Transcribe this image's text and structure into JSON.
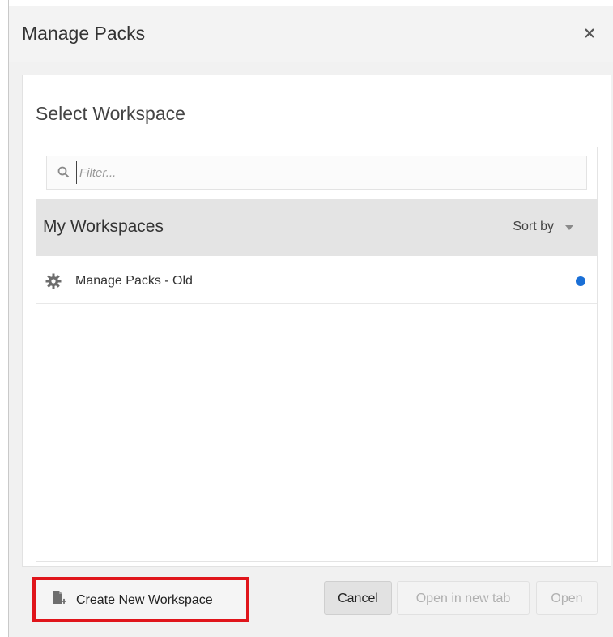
{
  "dialog": {
    "title": "Manage Packs",
    "close_icon": "close-icon"
  },
  "panel": {
    "section_title": "Select Workspace",
    "filter": {
      "placeholder": "Filter...",
      "value": "",
      "icon": "search-icon"
    },
    "group": {
      "title": "My Workspaces",
      "sort_label": "Sort by",
      "sort_icon": "chevron-down-icon"
    },
    "workspaces": [
      {
        "label": "Manage Packs - Old",
        "icon": "gear-icon",
        "status_dot_color": "#1a6fd6"
      }
    ]
  },
  "footer": {
    "create_label": "Create New Workspace",
    "create_icon": "new-document-icon",
    "highlight_color": "#e0151b",
    "cancel_label": "Cancel",
    "open_new_tab_label": "Open in new tab",
    "open_label": "Open"
  }
}
